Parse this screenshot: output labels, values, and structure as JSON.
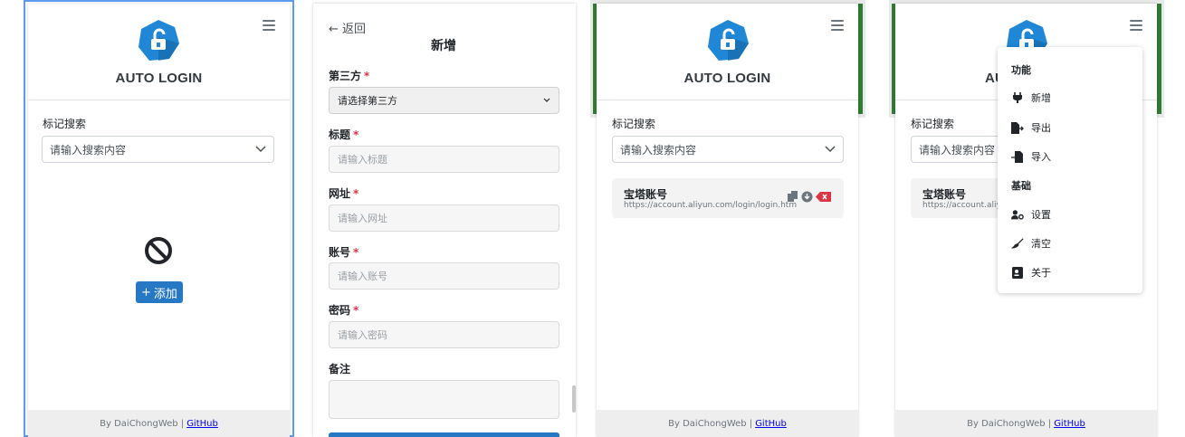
{
  "app": {
    "title": "AUTO LOGIN"
  },
  "search": {
    "label": "标记搜索",
    "placeholder": "请输入搜索内容"
  },
  "empty_state": {
    "add_button": "添加",
    "add_prefix": "+"
  },
  "footer": {
    "by_text": "By DaiChongWeb |",
    "link": "GitHub"
  },
  "form": {
    "back": "返回",
    "title": "新增",
    "third_party_label": "第三方",
    "third_party_value": "请选择第三方",
    "title_label": "标题",
    "title_placeholder": "请输入标题",
    "url_label": "网址",
    "url_placeholder": "请输入网址",
    "account_label": "账号",
    "account_placeholder": "请输入账号",
    "password_label": "密码",
    "password_placeholder": "请输入密码",
    "note_label": "备注",
    "required_mark": "*"
  },
  "record": {
    "title": "宝塔账号",
    "url": "https://account.aliyun.com/login/login.htm",
    "url_truncated": "https://account.aliyu"
  },
  "menu": {
    "section_functions": "功能",
    "add": "新增",
    "export": "导出",
    "import": "导入",
    "section_basic": "基础",
    "settings": "设置",
    "clear": "清空",
    "about": "关于"
  },
  "title_partial": "AU",
  "colors": {
    "accent_blue": "#2778c4",
    "logo_blue": "#1f87d6",
    "frame_green": "#2e7d32",
    "danger": "#dc3545"
  },
  "icons": [
    "lock-icon",
    "hamburger-icon",
    "chevron-down-icon",
    "ban-icon",
    "copy-icon",
    "download-icon",
    "delete-icon",
    "plug-icon",
    "file-export-icon",
    "file-import-icon",
    "user-cog-icon",
    "broom-icon",
    "id-card-icon",
    "arrow-left-icon"
  ]
}
